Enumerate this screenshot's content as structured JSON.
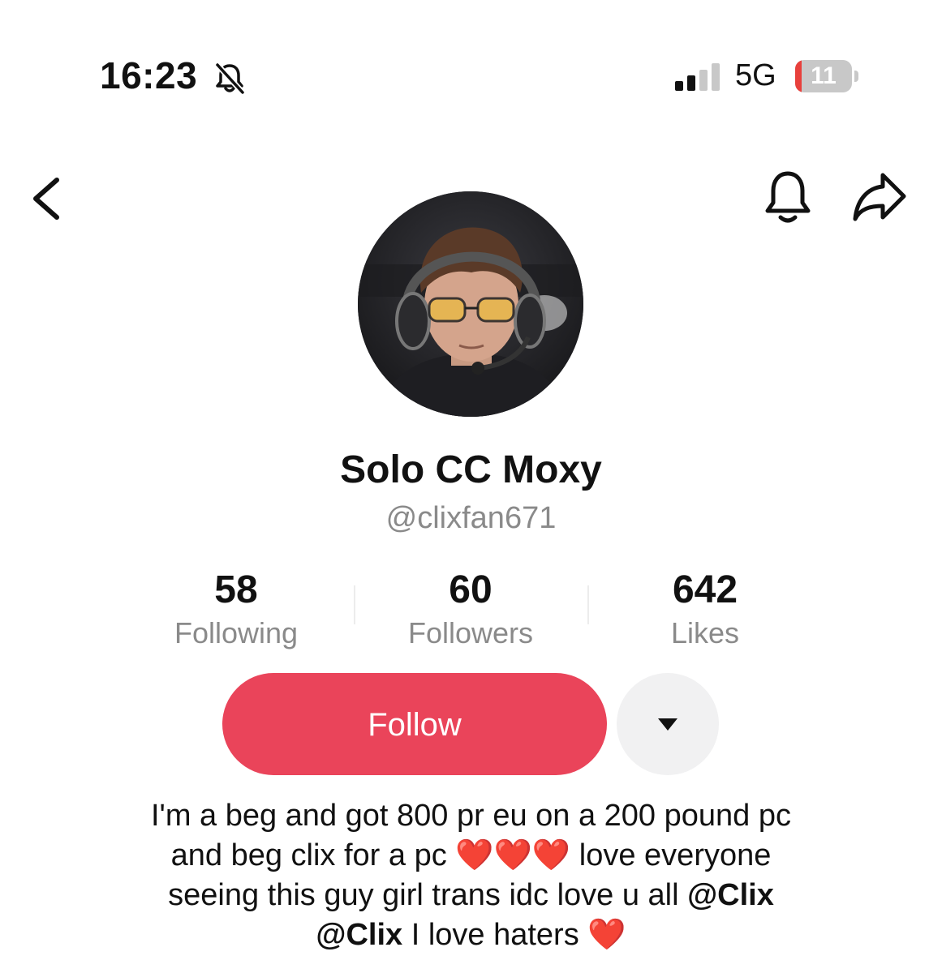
{
  "status_bar": {
    "time": "16:23",
    "silent_icon": "bell-slash-icon",
    "signal_icon": "cellular-signal-icon",
    "network": "5G",
    "battery_level": "11",
    "battery_percent": 11,
    "battery_color": "#e8403c"
  },
  "nav": {
    "back_icon": "chevron-left-icon",
    "notifications_icon": "bell-icon",
    "share_icon": "share-arrow-icon"
  },
  "profile": {
    "display_name": "Solo CC Moxy",
    "username": "@clixfan671"
  },
  "stats": [
    {
      "value": "58",
      "label": "Following"
    },
    {
      "value": "60",
      "label": "Followers"
    },
    {
      "value": "642",
      "label": "Likes"
    }
  ],
  "actions": {
    "follow_label": "Follow",
    "follow_color": "#ea445a",
    "more_icon": "caret-down-icon"
  },
  "bio": {
    "line1": "I'm a beg and got 800 pr eu on a 200 pound pc",
    "line2_text": "and beg clix for a pc",
    "line2_hearts": "❤️❤️❤️",
    "line2_tail": "love everyone",
    "line3_text": "seeing this guy girl trans idc love u all",
    "mention1": "@Clix",
    "mention2": "@Clix",
    "line4_text": "I love haters",
    "line4_heart": "❤️"
  }
}
